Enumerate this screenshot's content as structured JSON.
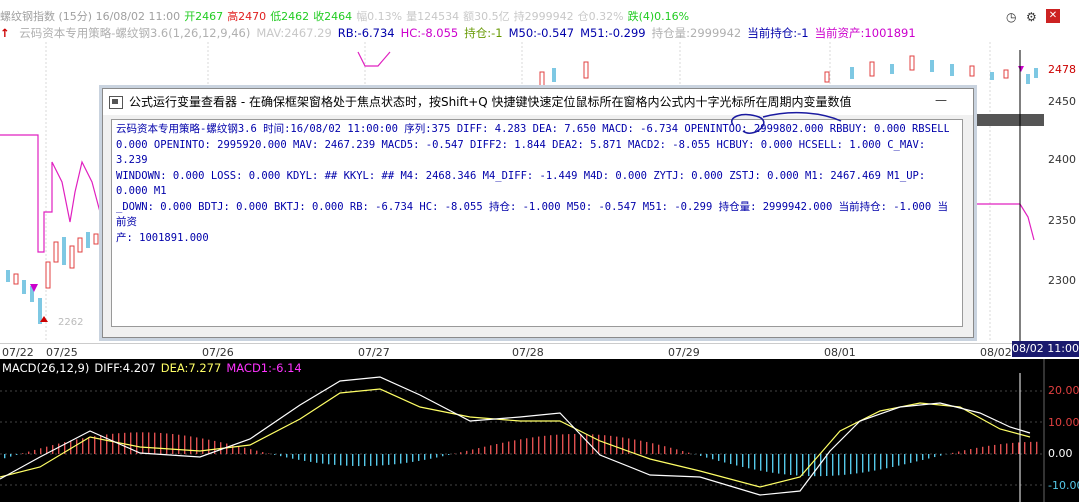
{
  "topbar": {
    "items": [
      {
        "text": "螺纹钢指数 (15分) 16/08/02 11:00",
        "color": "#a0a0a0"
      },
      {
        "text": "开2467",
        "color": "#22cc22"
      },
      {
        "text": "高2470",
        "color": "#e02020"
      },
      {
        "text": "低2462",
        "color": "#22cc22"
      },
      {
        "text": "收2464",
        "color": "#22cc22"
      },
      {
        "text": "幅0.13%",
        "color": "#c8c8c8"
      },
      {
        "text": "量124534",
        "color": "#c8c8c8"
      },
      {
        "text": "额30.5亿",
        "color": "#c8c8c8"
      },
      {
        "text": "持2999942",
        "color": "#c8c8c8"
      },
      {
        "text": "仓0.32%",
        "color": "#c8c8c8"
      },
      {
        "text": "跌(4)0.16%",
        "color": "#22cc22"
      }
    ]
  },
  "stratbar": {
    "items": [
      {
        "text": "云码资本专用策略-螺纹钢3.6(1,26,12,9,46)",
        "color": "#b0b0b0"
      },
      {
        "text": "MAV:2467.29",
        "color": "#c8c8c8"
      },
      {
        "text": "RB:-6.734",
        "color": "#0000aa"
      },
      {
        "text": "HC:-8.055",
        "color": "#cc00cc"
      },
      {
        "text": "持仓:-1",
        "color": "#669900"
      },
      {
        "text": "M50:-0.547",
        "color": "#0000aa"
      },
      {
        "text": "M51:-0.299",
        "color": "#0000aa"
      },
      {
        "text": "持仓量:2999942",
        "color": "#b0b0b0"
      },
      {
        "text": "当前持仓:-1",
        "color": "#0000aa"
      },
      {
        "text": "当前资产:1001891",
        "color": "#cc00cc"
      }
    ]
  },
  "price_axis": {
    "ticks": [
      "2478",
      "2450",
      "2400",
      "2350",
      "2300"
    ],
    "current": "2478"
  },
  "date_axis": {
    "ticks": [
      "07/22",
      "07/25",
      "07/26",
      "07/27",
      "07/28",
      "07/29",
      "08/01",
      "08/02"
    ],
    "current_time": "08/02 11:00"
  },
  "macd": {
    "legend": [
      {
        "text": "MACD(26,12,9)",
        "color": "#ffffff"
      },
      {
        "text": "DIFF:4.207",
        "color": "#ffffff"
      },
      {
        "text": "DEA:7.277",
        "color": "#ffff66"
      },
      {
        "text": "MACD1:-6.14",
        "color": "#ff33ff"
      }
    ],
    "ticks": [
      "20.00",
      "10.00",
      "0.00",
      "-10.00"
    ]
  },
  "dialog": {
    "title": "公式运行变量查看器 - 在确保框架窗格处于焦点状态时，按Shift+Q 快捷键快速定位鼠标所在窗格内公式内十字光标所在周期内变量数值",
    "minimize_label": "—",
    "lines": [
      "云码资本专用策略-螺纹钢3.6 时间:16/08/02 11:00:00 序列:375  DIFF: 4.283 DEA: 7.650 MACD: -6.734 OPENINTOO: 2999802.000 RBBUY: 0.000 RBSELL:",
      "0.000 OPENINTO: 2995920.000 MAV: 2467.239 MACD5: -0.547 DIFF2: 1.844 DEA2: 5.871 MACD2: -8.055 HCBUY: 0.000 HCSELL: 1.000 C_MAV: 3.239",
      "WINDOWN: 0.000 LOSS: 0.000 KDYL: ## KKYL: ## M4: 2468.346 M4_DIFF: -1.449 M4D: 0.000 ZYTJ: 0.000 ZSTJ: 0.000 M1: 2467.469 M1_UP: 0.000 M1",
      "_DOWN: 0.000 BDTJ: 0.000 BKTJ: 0.000 RB: -6.734 HC: -8.055 持仓: -1.000 M50: -0.547 M51: -0.299 持仓量: 2999942.000 当前持仓: -1.000 当前资",
      "产: 1001891.000"
    ]
  },
  "icons": {
    "arrow_up": "↑",
    "clock": "🕑",
    "gear": "⚙",
    "close": "✕"
  }
}
